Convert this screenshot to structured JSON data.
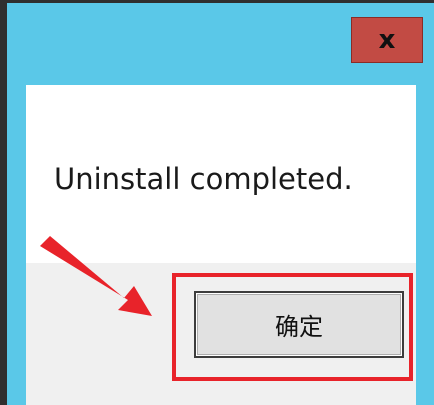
{
  "dialog": {
    "close_label": "x",
    "message": "Uninstall completed.",
    "ok_label": "确定"
  },
  "colors": {
    "frame": "#5ac8e8",
    "close_button": "#c24b44",
    "annotation": "#e8232a"
  },
  "annotation": {
    "type": "arrow-and-box",
    "target": "ok-button"
  }
}
